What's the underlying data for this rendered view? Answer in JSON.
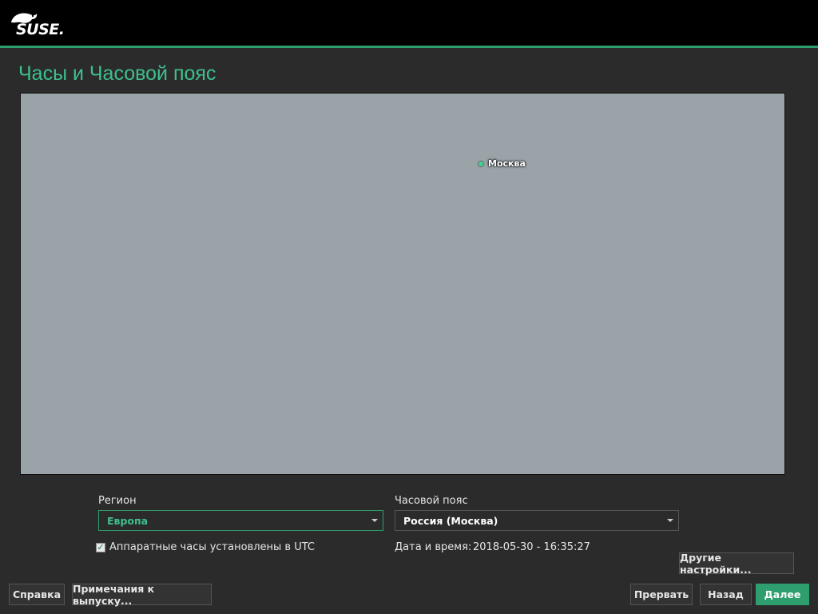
{
  "brand": {
    "logo_text": "SUSE."
  },
  "page": {
    "title": "Часы и Часовой пояс"
  },
  "map": {
    "selected_city": "Москва"
  },
  "region": {
    "label": "Регион",
    "value": "Европа"
  },
  "timezone": {
    "label": "Часовой пояс",
    "value": "Россия (Москва)"
  },
  "hardware_clock": {
    "label": "Аппаратные часы установлены в UTC",
    "checked": true
  },
  "datetime": {
    "label": "Дата и время:",
    "value": "2018-05-30 - 16:35:27"
  },
  "buttons": {
    "other_settings": "Другие настройки...",
    "help": "Справка",
    "release_notes": "Примечания к выпуску...",
    "abort": "Прервать",
    "back": "Назад",
    "next": "Далее"
  },
  "colors": {
    "accent": "#2f9e6e",
    "title": "#3dc08d",
    "background": "#2b2b2b"
  }
}
